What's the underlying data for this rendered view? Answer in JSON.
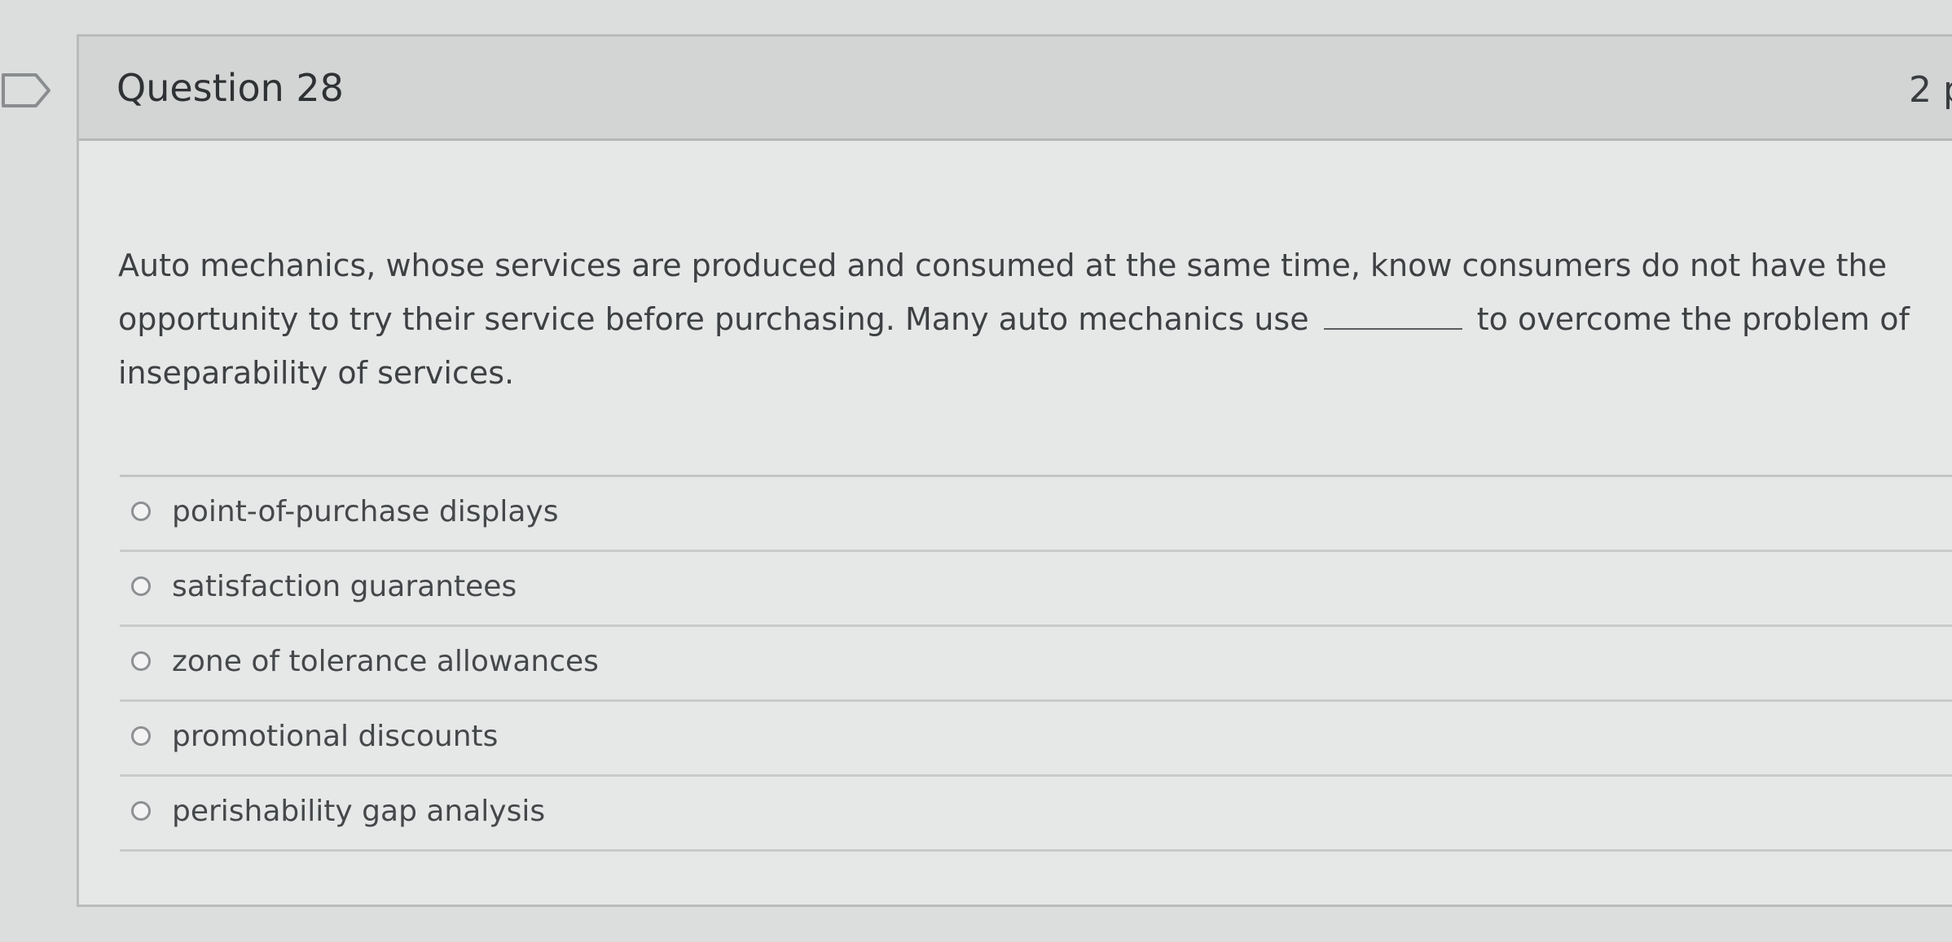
{
  "question": {
    "title": "Question 28",
    "points": "2 p",
    "text_before_blank": "Auto mechanics, whose services are produced and consumed at the same time, know consumers do not have the opportunity to try their service before purchasing. Many auto mechanics use",
    "text_after_blank": "to overcome the problem of inseparability of services.",
    "answers": [
      {
        "label": "point-of-purchase displays"
      },
      {
        "label": "satisfaction guarantees"
      },
      {
        "label": "zone of tolerance allowances"
      },
      {
        "label": "promotional discounts"
      },
      {
        "label": "perishability gap analysis"
      }
    ]
  },
  "icons": {
    "bookmark": "bookmark-flag-icon",
    "radio": "radio-button-icon"
  },
  "colors": {
    "page_background": "#dcdddd",
    "header_background": "#d3d4d4",
    "text": "#3e4143"
  }
}
